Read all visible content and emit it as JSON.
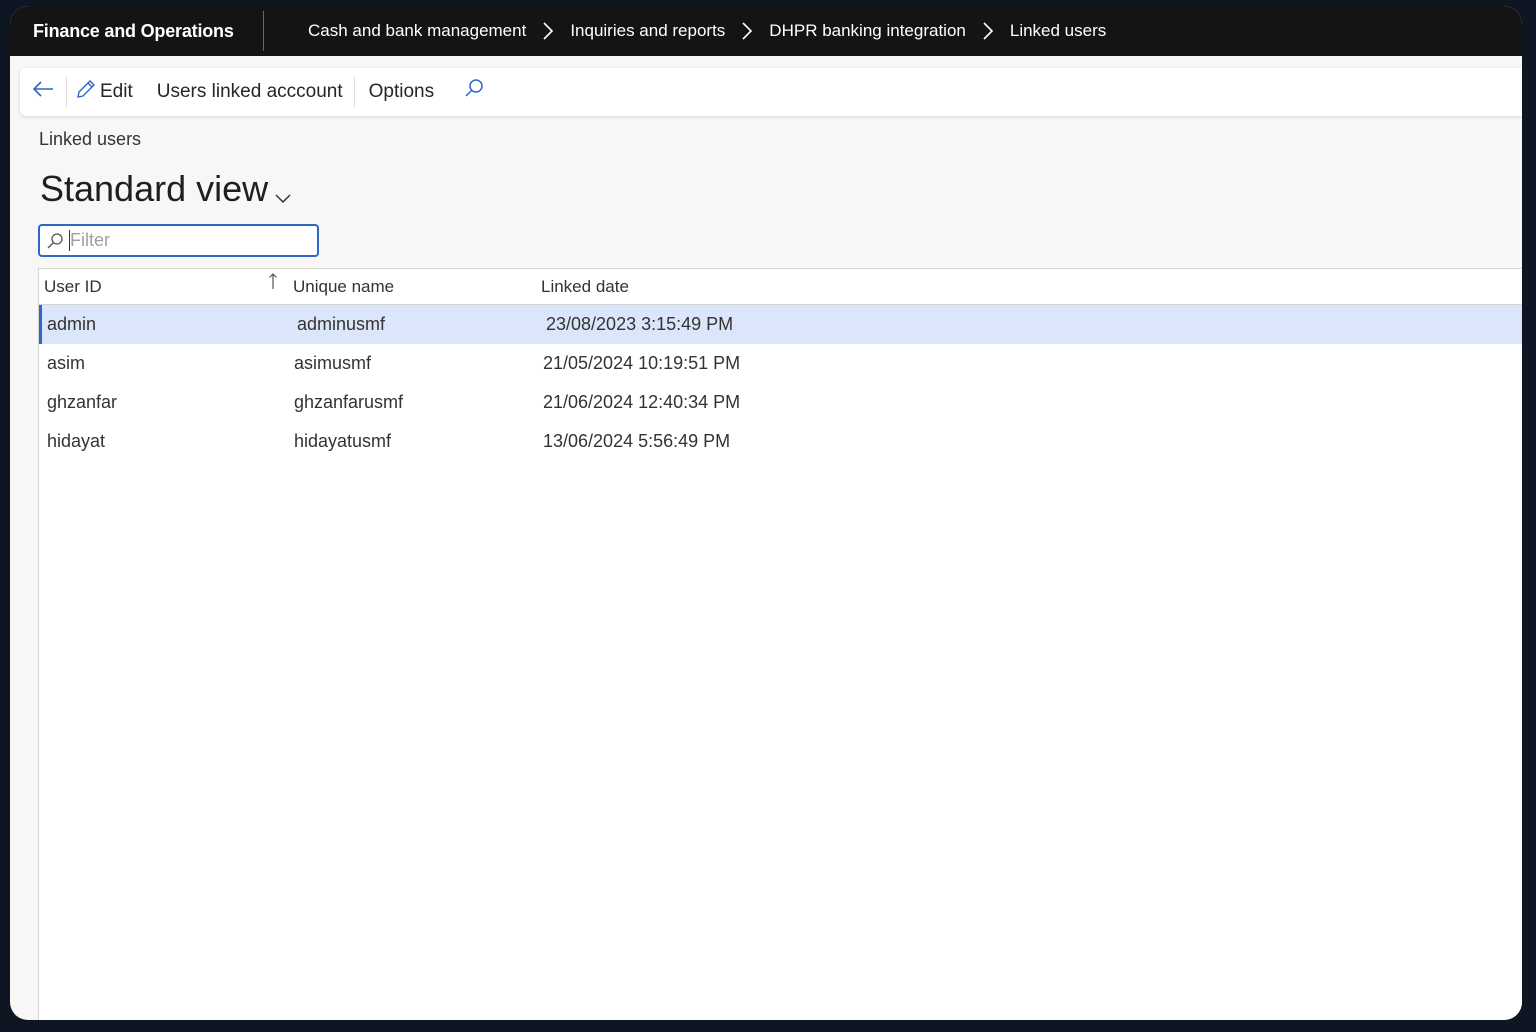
{
  "header": {
    "app_name": "Finance and Operations",
    "breadcrumb": [
      "Cash and bank management",
      "Inquiries and reports",
      "DHPR banking integration",
      "Linked users"
    ]
  },
  "actionpane": {
    "back_icon": "arrow-left-icon",
    "edit_label": "Edit",
    "edit_icon": "pencil-icon",
    "users_linked_label": "Users linked acccount",
    "options_label": "Options",
    "search_icon": "search-icon"
  },
  "page": {
    "caption": "Linked users",
    "view_title": "Standard view"
  },
  "filter": {
    "placeholder": "Filter"
  },
  "grid": {
    "columns": [
      "User ID",
      "Unique name",
      "Linked date"
    ],
    "sorted_column": "User ID",
    "sort_direction": "ascending",
    "rows": [
      {
        "user_id": "admin",
        "unique_name": "adminusmf",
        "linked_date": "23/08/2023 3:15:49 PM",
        "selected": true
      },
      {
        "user_id": "asim",
        "unique_name": "asimusmf",
        "linked_date": "21/05/2024 10:19:51 PM",
        "selected": false
      },
      {
        "user_id": "ghzanfar",
        "unique_name": "ghzanfarusmf",
        "linked_date": "21/06/2024 12:40:34 PM",
        "selected": false
      },
      {
        "user_id": "hidayat",
        "unique_name": "hidayatusmf",
        "linked_date": "13/06/2024 5:56:49 PM",
        "selected": false
      }
    ]
  },
  "colors": {
    "topbar": "#141414",
    "accent": "#2e67c7",
    "selected_row": "#dbe6fa"
  }
}
